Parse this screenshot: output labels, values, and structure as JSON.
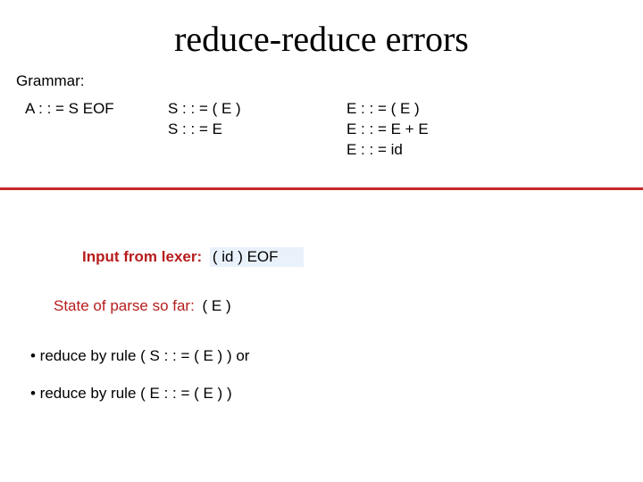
{
  "title": "reduce-reduce errors",
  "grammar_label": "Grammar:",
  "rules": {
    "A": "A : : = S EOF",
    "S1": "S : : = ( E )",
    "S2": "S : : = E",
    "E1": "E : : = ( E )",
    "E2": "E : : = E + E",
    "E3": "E : : = id"
  },
  "lexer_label": "Input from lexer:",
  "lexer_input": "( id ) EOF",
  "state_label": "State of parse so far:",
  "state_value": "( E )",
  "bullet1": "• reduce by rule ( S : : = ( E ) ) or",
  "bullet2": "• reduce by rule ( E : : = ( E ) )"
}
